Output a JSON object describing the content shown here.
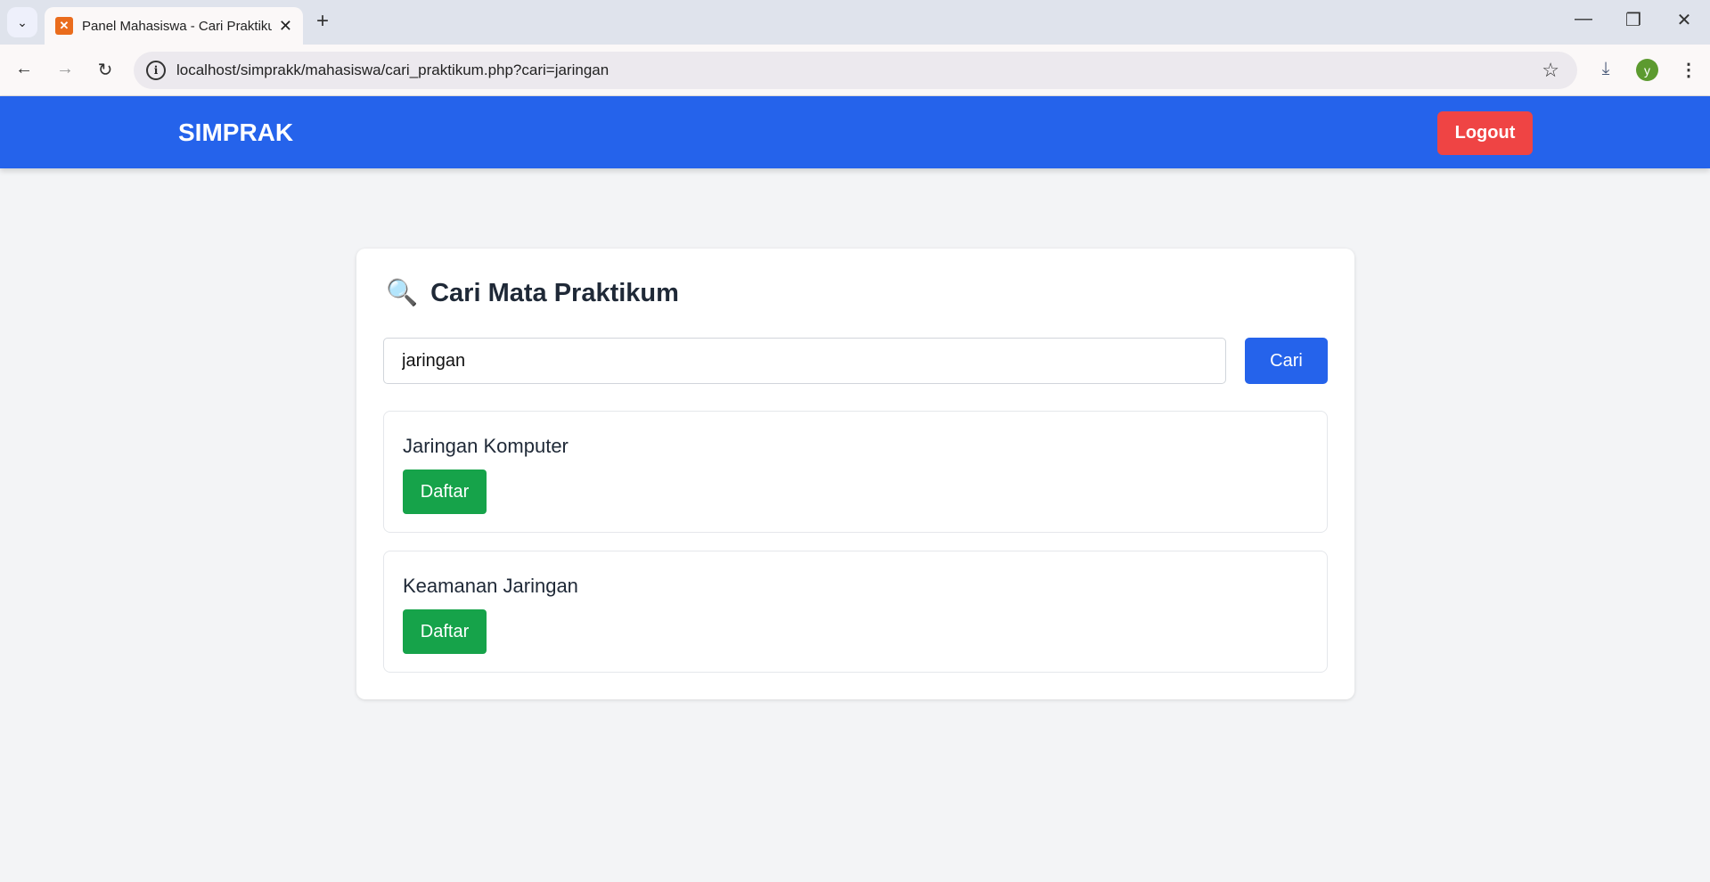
{
  "browser": {
    "tab_title": "Panel Mahasiswa - Cari Praktikum",
    "url": "localhost/simprakk/mahasiswa/cari_praktikum.php?cari=jaringan",
    "profile_initial": "y"
  },
  "header": {
    "brand": "SIMPRAK",
    "logout_label": "Logout"
  },
  "search": {
    "title": "Cari Mata Praktikum",
    "icon": "🔍",
    "value": "jaringan",
    "button_label": "Cari"
  },
  "results": [
    {
      "name": "Jaringan Komputer",
      "button_label": "Daftar"
    },
    {
      "name": "Keamanan Jaringan",
      "button_label": "Daftar"
    }
  ],
  "colors": {
    "primary": "#2563eb",
    "danger": "#ef4444",
    "success": "#16a34a"
  }
}
